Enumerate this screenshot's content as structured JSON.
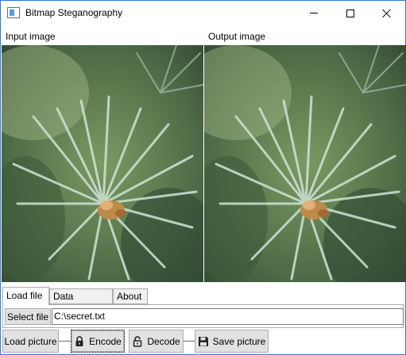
{
  "window": {
    "title": "Bitmap Steganography"
  },
  "images": {
    "input_label": "Input image",
    "output_label": "Output image"
  },
  "tabs": [
    {
      "label": "Load file",
      "active": true
    },
    {
      "label": "Data analysis",
      "active": false
    },
    {
      "label": "About",
      "active": false
    }
  ],
  "load_file": {
    "select_button": "Select file",
    "path_value": "C:\\secret.txt"
  },
  "toolbar": {
    "load_picture": "Load picture",
    "encode": "Encode",
    "decode": "Decode",
    "save_picture": "Save picture"
  },
  "icons": {
    "app": "window-icon",
    "encode": "lock-icon",
    "decode": "unlock-icon",
    "save": "floppy-disk-icon"
  }
}
